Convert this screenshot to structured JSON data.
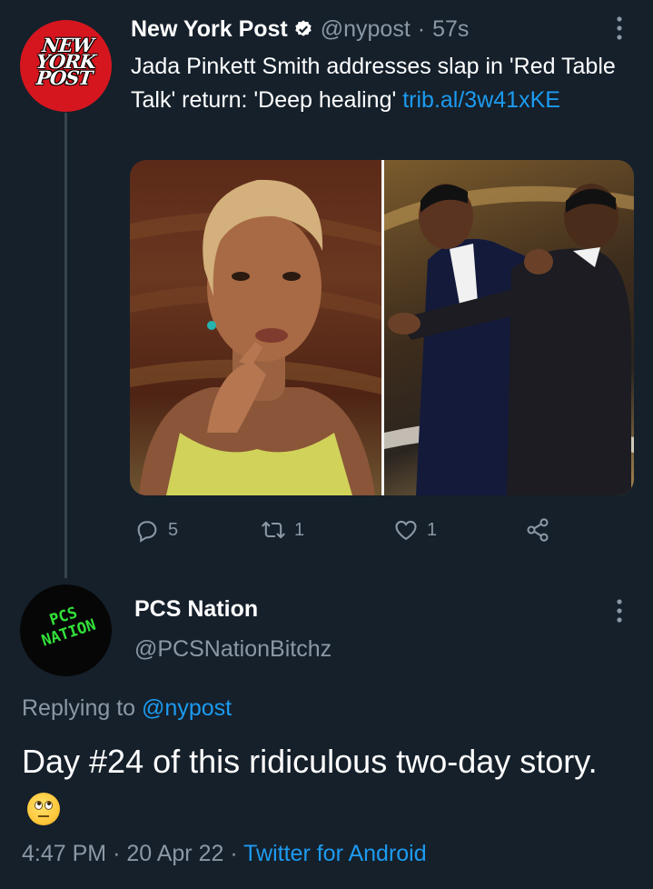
{
  "tweet": {
    "author_name": "New York Post",
    "author_handle": "@nypost",
    "separator": "·",
    "time_ago": "57s",
    "avatar_logo": "NEW YORK POST",
    "text": "Jada Pinkett Smith addresses slap in 'Red Table Talk' return: 'Deep healing' ",
    "link": "trib.al/3w41xKE",
    "verified_icon": "verified-badge-icon",
    "actions": {
      "replies": "5",
      "retweets": "1",
      "likes": "1"
    }
  },
  "reply": {
    "author_name": "PCS Nation",
    "author_handle": "@PCSNationBitchz",
    "avatar_logo": "PCS NATION",
    "replying_prefix": "Replying to",
    "replying_handle": "@nypost",
    "text": "Day #24 of this ridiculous two-day story.",
    "emoji": "face-with-rolling-eyes",
    "time": "4:47 PM",
    "date": "20 Apr 22",
    "source": "Twitter for Android",
    "separator": "·"
  },
  "colors": {
    "background": "#15202b",
    "accent": "#1d9bf0",
    "muted": "#8b98a5",
    "nypost_red": "#d6161e",
    "pcs_green": "#33e03a"
  }
}
